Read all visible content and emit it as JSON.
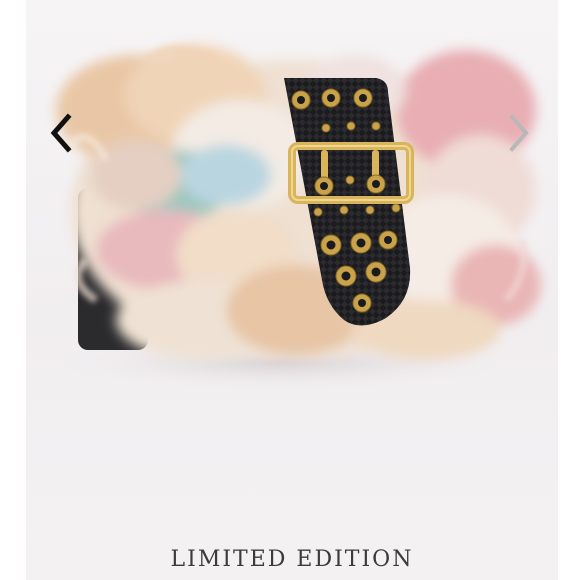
{
  "gallery": {
    "product_image_icon": "fur-clutch-bag-image",
    "prev_icon": "chevron-left-icon",
    "next_icon": "chevron-right-icon",
    "prev_color": "#111111",
    "next_color": "#b8b8b8"
  },
  "caption": {
    "label": "LIMITED EDITION"
  }
}
